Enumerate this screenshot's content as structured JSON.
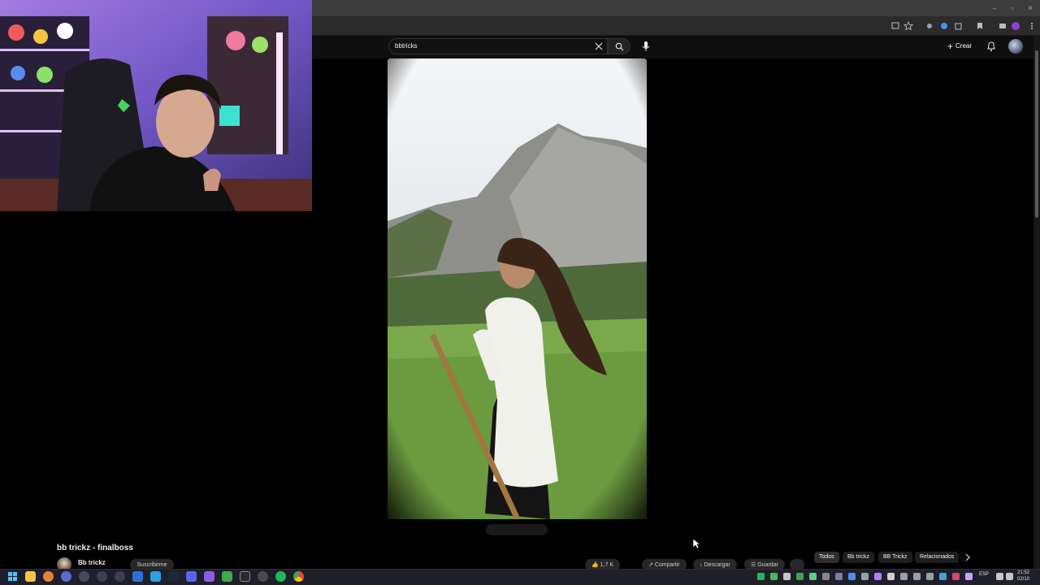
{
  "search": {
    "value": "bbtricks"
  },
  "header": {
    "create_label": "Crear"
  },
  "video": {
    "title": "bb trickz - finalboss",
    "channel": "Bb trickz",
    "subscribe_label": "Suscribirme",
    "likes": "1,7 K",
    "share_label": "Compartir",
    "download_label": "Descargar",
    "save_label": "Guardar"
  },
  "chips": [
    {
      "label": "Todos",
      "active": true
    },
    {
      "label": "Bb trickz",
      "active": false
    },
    {
      "label": "BB Trickz",
      "active": false
    },
    {
      "label": "Relacionados",
      "active": false
    }
  ],
  "taskbar": {
    "language": "ESP",
    "time": "21:52",
    "date": "02/10"
  },
  "icons": {
    "search": "search-icon",
    "mic": "microphone-icon",
    "bell": "bell-icon",
    "create": "plus-icon"
  }
}
